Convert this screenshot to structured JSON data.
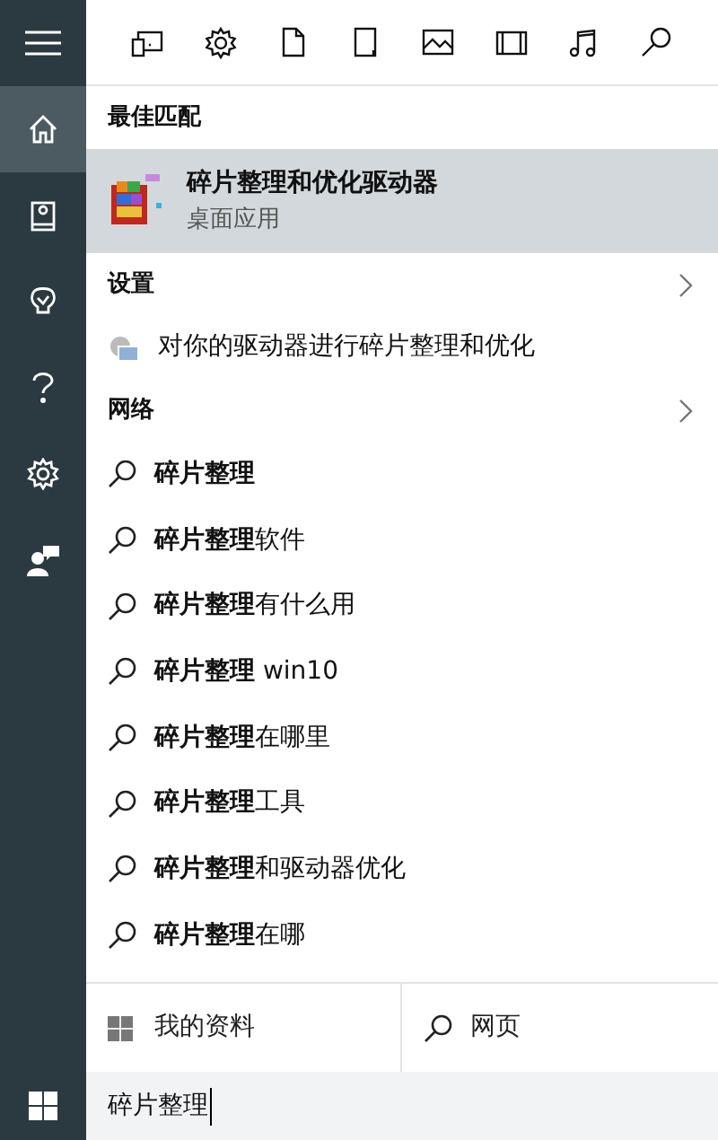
{
  "sidebar": {
    "items": [
      {
        "selected": false
      },
      {
        "selected": true
      },
      {
        "selected": false
      },
      {
        "selected": false
      },
      {
        "selected": false
      },
      {
        "selected": false
      },
      {
        "selected": false
      }
    ]
  },
  "best_match": {
    "heading": "最佳匹配",
    "title": "碎片整理和优化驱动器",
    "subtitle": "桌面应用",
    "selected": true
  },
  "settings": {
    "heading": "设置",
    "items": [
      "对你的驱动器进行碎片整理和优化"
    ]
  },
  "web": {
    "heading": "网络",
    "suggestions": [
      "**碎片整理**",
      "**碎片整理**软件",
      "**碎片整理**有什么用",
      "**碎片整理** win10",
      "**碎片整理**在哪里",
      "**碎片整理**工具",
      "**碎片整理**和驱动器优化",
      "**碎片整理**在哪"
    ]
  },
  "scope": {
    "left": "我的资料",
    "right": "网页"
  },
  "search": {
    "value": "碎片整理"
  }
}
